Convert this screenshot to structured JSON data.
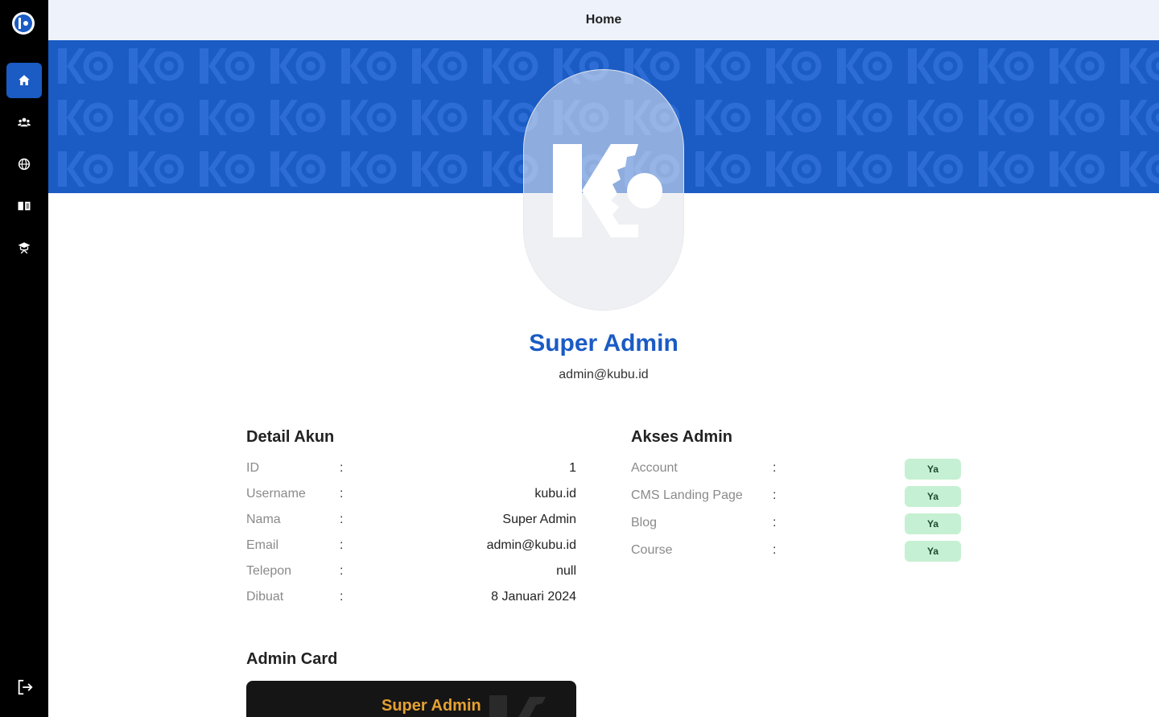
{
  "header": {
    "title": "Home"
  },
  "sidebar": {
    "items": [
      {
        "icon": "home-icon",
        "active": true
      },
      {
        "icon": "users-icon",
        "active": false
      },
      {
        "icon": "globe-icon",
        "active": false
      },
      {
        "icon": "book-icon",
        "active": false
      },
      {
        "icon": "graduation-cap-icon",
        "active": false
      }
    ],
    "logout_icon": "logout-icon"
  },
  "profile": {
    "name": "Super Admin",
    "email": "admin@kubu.id"
  },
  "account_details": {
    "title": "Detail Akun",
    "separator": ":",
    "rows": [
      {
        "label": "ID",
        "value": "1"
      },
      {
        "label": "Username",
        "value": "kubu.id"
      },
      {
        "label": "Nama",
        "value": "Super Admin"
      },
      {
        "label": "Email",
        "value": "admin@kubu.id"
      },
      {
        "label": "Telepon",
        "value": "null"
      },
      {
        "label": "Dibuat",
        "value": "8 Januari 2024"
      }
    ]
  },
  "admin_access": {
    "title": "Akses Admin",
    "separator": ":",
    "rows": [
      {
        "label": "Account",
        "value": "Ya"
      },
      {
        "label": "CMS Landing Page",
        "value": "Ya"
      },
      {
        "label": "Blog",
        "value": "Ya"
      },
      {
        "label": "Course",
        "value": "Ya"
      }
    ]
  },
  "admin_card": {
    "title": "Admin Card",
    "name": "Super Admin"
  },
  "colors": {
    "brand_blue": "#1a5bc4",
    "sidebar_bg": "#000000",
    "badge_bg": "#c6f0d3",
    "card_accent": "#e5a132"
  }
}
